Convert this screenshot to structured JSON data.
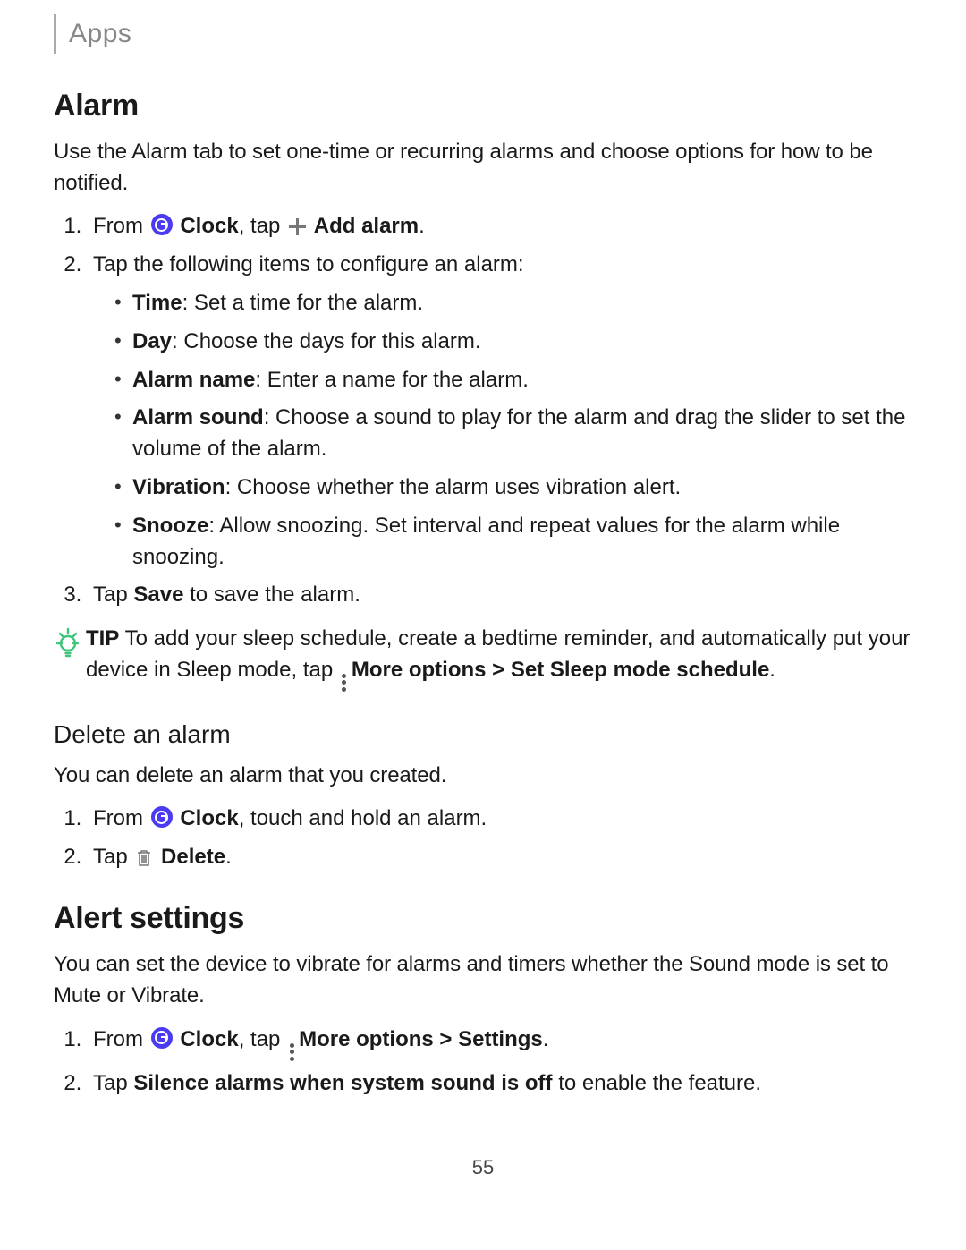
{
  "header": {
    "section": "Apps"
  },
  "alarm": {
    "title": "Alarm",
    "intro": "Use the Alarm tab to set one-time or recurring alarms and choose options for how to be notified.",
    "step1": {
      "from": "From ",
      "clock": "Clock",
      "tap": ", tap ",
      "add": "Add alarm",
      "end": "."
    },
    "step2_intro": "Tap the following items to configure an alarm:",
    "options": {
      "time": {
        "label": "Time",
        "text": ": Set a time for the alarm."
      },
      "day": {
        "label": "Day",
        "text": ": Choose the days for this alarm."
      },
      "name": {
        "label": "Alarm name",
        "text": ": Enter a name for the alarm."
      },
      "sound": {
        "label": "Alarm sound",
        "text": ": Choose a sound to play for the alarm and drag the slider to set the volume of the alarm."
      },
      "vibration": {
        "label": "Vibration",
        "text": ": Choose whether the alarm uses vibration alert."
      },
      "snooze": {
        "label": "Snooze",
        "text": ": Allow snoozing. Set interval and repeat values for the alarm while snoozing."
      }
    },
    "step3": {
      "pre": "Tap ",
      "save": "Save",
      "post": " to save the alarm."
    },
    "tip": {
      "label": "TIP",
      "pre": "  To add your sleep schedule, create a bedtime reminder, and automatically put your device in Sleep mode, tap ",
      "more": "More options",
      "gt": " > ",
      "set": "Set Sleep mode schedule",
      "end": "."
    }
  },
  "delete": {
    "title": "Delete an alarm",
    "intro": "You can delete an alarm that you created.",
    "step1": {
      "from": "From ",
      "clock": "Clock",
      "post": ", touch and hold an alarm."
    },
    "step2": {
      "pre": "Tap ",
      "delete": "Delete",
      "end": "."
    }
  },
  "alert": {
    "title": "Alert settings",
    "intro": "You can set the device to vibrate for alarms and timers whether the Sound mode is set to Mute or Vibrate.",
    "step1": {
      "from": "From ",
      "clock": "Clock",
      "tap": ", tap ",
      "more": "More options",
      "gt": " > ",
      "settings": "Settings",
      "end": "."
    },
    "step2": {
      "pre": "Tap ",
      "bold": "Silence alarms when system sound is off",
      "post": " to enable the feature."
    }
  },
  "page_number": "55"
}
